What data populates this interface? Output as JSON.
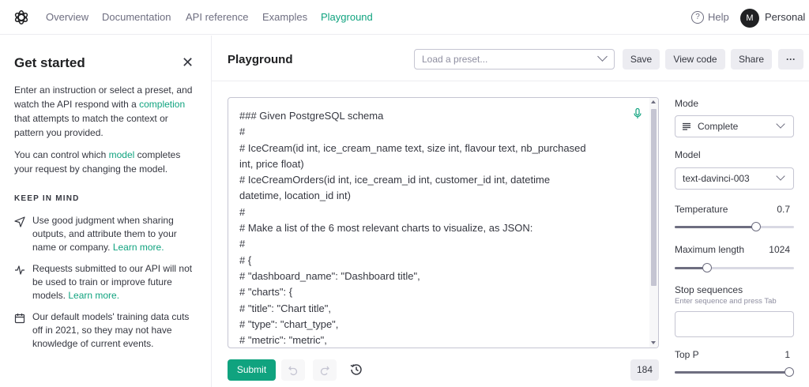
{
  "nav": {
    "links": [
      "Overview",
      "Documentation",
      "API reference",
      "Examples",
      "Playground"
    ],
    "help": "Help",
    "avatar_initial": "M",
    "account": "Personal"
  },
  "sidebar": {
    "title": "Get started",
    "para1_a": "Enter an instruction or select a preset, and watch the API respond with a ",
    "para1_link": "completion",
    "para1_b": " that attempts to match the context or pattern you provided.",
    "para2_a": "You can control which ",
    "para2_link": "model",
    "para2_b": " completes your request by changing the model.",
    "keep_in_mind": "KEEP IN MIND",
    "tips": [
      {
        "icon": "send-icon",
        "text": "Use good judgment when sharing outputs, and attribute them to your name or company. ",
        "link": "Learn more."
      },
      {
        "icon": "activity-icon",
        "text": "Requests submitted to our API will not be used to train or improve future models. ",
        "link": "Learn more."
      },
      {
        "icon": "calendar-icon",
        "text": "Our default models' training data cuts off in 2021, so they may not have knowledge of current events.",
        "link": ""
      }
    ]
  },
  "header": {
    "title": "Playground",
    "preset_placeholder": "Load a preset...",
    "save": "Save",
    "view_code": "View code",
    "share": "Share",
    "more": "···"
  },
  "editor": {
    "lines": [
      "### Given PostgreSQL schema",
      "#",
      "# IceCream(id int, ice_cream_name text, size int, flavour text, nb_purchased",
      "int, price float)",
      "# IceCreamOrders(id int, ice_cream_id int, customer_id int, datetime",
      "datetime, location_id int)",
      "#",
      "# Make a list of the 6 most relevant charts to visualize, as JSON:",
      "#",
      "# {",
      "# \"dashboard_name\": \"Dashboard title\",",
      "# \"charts\": {",
      "#   \"title\": \"Chart title\",",
      "#   \"type\": \"chart_type\",",
      "#   \"metric\": \"metric\","
    ]
  },
  "footer": {
    "submit": "Submit",
    "token_count": "184"
  },
  "settings": {
    "mode_label": "Mode",
    "mode_value": "Complete",
    "model_label": "Model",
    "model_value": "text-davinci-003",
    "temperature_label": "Temperature",
    "temperature_value": "0.7",
    "temperature_fraction": 0.7,
    "max_length_label": "Maximum length",
    "max_length_value": "1024",
    "max_length_fraction": 0.25,
    "stop_label": "Stop sequences",
    "stop_hint": "Enter sequence and press Tab",
    "top_p_label": "Top P",
    "top_p_value": "1",
    "top_p_fraction": 1.0
  },
  "colors": {
    "accent": "#10a37f",
    "text": "#353740",
    "muted": "#6e6e80",
    "border": "#c5c5d2"
  }
}
